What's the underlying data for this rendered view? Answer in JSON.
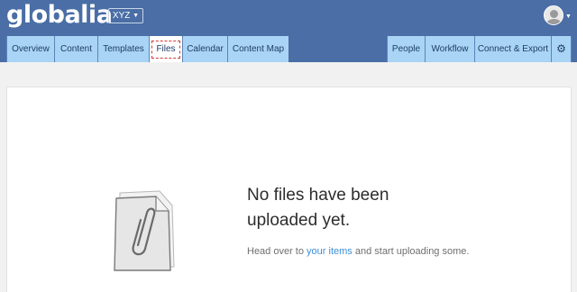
{
  "app": {
    "logo": "globalia",
    "org_selector": "XYZ"
  },
  "tabs_left": [
    {
      "label": "Overview"
    },
    {
      "label": "Content"
    },
    {
      "label": "Templates"
    },
    {
      "label": "Files"
    },
    {
      "label": "Calendar"
    },
    {
      "label": "Content Map"
    }
  ],
  "tabs_right": [
    {
      "label": "People"
    },
    {
      "label": "Workflow"
    },
    {
      "label": "Connect & Export"
    }
  ],
  "icons": {
    "settings": "gear-icon",
    "empty_state": "paperclip-document-icon",
    "user": "avatar-icon"
  },
  "active_tab": "Files",
  "empty_state": {
    "title": "No files have been uploaded yet.",
    "sub_before": "Head over to ",
    "sub_link": "your items",
    "sub_after": " and start uploading some."
  },
  "colors": {
    "header": "#4a6ea5",
    "tab": "#a9d4f5",
    "link": "#3c8fd6",
    "highlight": "#d23a3a"
  }
}
